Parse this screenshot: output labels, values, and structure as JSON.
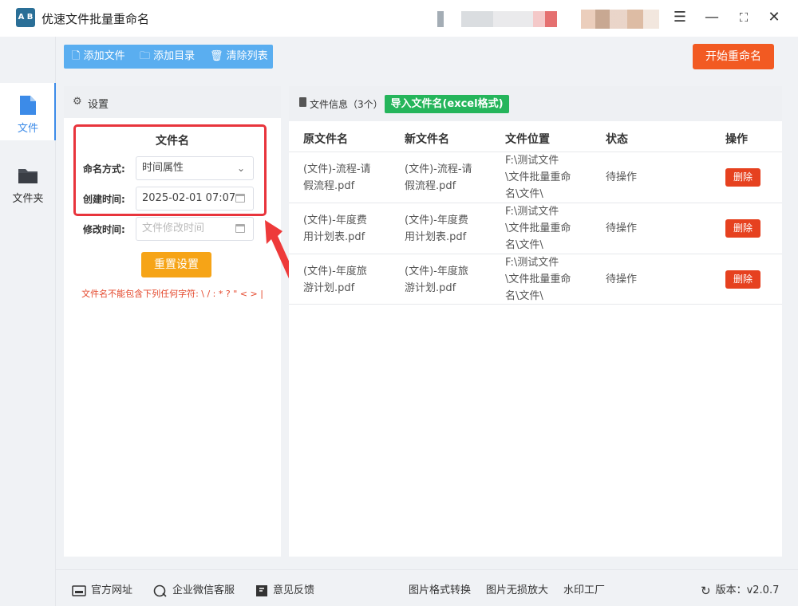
{
  "app": {
    "title": "优速文件批量重命名",
    "logo_text": "A B"
  },
  "window_controls": {
    "menu": "☰",
    "minimize": "—",
    "maximize": "⛶",
    "close": "✕"
  },
  "nav": {
    "items": [
      {
        "label": "文件",
        "icon": "file-icon",
        "active": true
      },
      {
        "label": "文件夹",
        "icon": "folder-icon",
        "active": false
      }
    ]
  },
  "toolbar": {
    "add_file": "添加文件",
    "add_dir": "添加目录",
    "clear_list": "清除列表",
    "start": "开始重命名"
  },
  "settings": {
    "header": "设置",
    "section_title": "文件名",
    "naming_label": "命名方式:",
    "naming_value": "时间属性",
    "created_label": "创建时间:",
    "created_value": "2025-02-01 07:07",
    "modified_label": "修改时间:",
    "modified_placeholder": "文件修改时间",
    "reset": "重置设置",
    "warning": "文件名不能包含下列任何字符: \\ / : * ? \" < > |"
  },
  "files": {
    "header": "文件信息（3个）",
    "import_btn": "导入文件名(excel格式)",
    "columns": [
      "原文件名",
      "新文件名",
      "文件位置",
      "状态",
      "操作"
    ],
    "rows": [
      {
        "orig_1": "(文件)-流程-请",
        "orig_2": "假流程.pdf",
        "new_1": "(文件)-流程-请",
        "new_2": "假流程.pdf",
        "loc_1": "F:\\测试文件",
        "loc_2": "\\文件批量重命",
        "loc_3": "名\\文件\\",
        "status": "待操作",
        "action": "删除"
      },
      {
        "orig_1": "(文件)-年度费",
        "orig_2": "用计划表.pdf",
        "new_1": "(文件)-年度费",
        "new_2": "用计划表.pdf",
        "loc_1": "F:\\测试文件",
        "loc_2": "\\文件批量重命",
        "loc_3": "名\\文件\\",
        "status": "待操作",
        "action": "删除"
      },
      {
        "orig_1": "(文件)-年度旅",
        "orig_2": "游计划.pdf",
        "new_1": "(文件)-年度旅",
        "new_2": "游计划.pdf",
        "loc_1": "F:\\测试文件",
        "loc_2": "\\文件批量重命",
        "loc_3": "名\\文件\\",
        "status": "待操作",
        "action": "删除"
      }
    ]
  },
  "bottom": {
    "website": "官方网址",
    "wechat": "企业微信客服",
    "feedback": "意见反馈",
    "img_convert": "图片格式转换",
    "img_enlarge": "图片无损放大",
    "watermark": "水印工厂",
    "version": "版本：v2.0.7"
  },
  "colors": {
    "accent_blue": "#3c8be8",
    "start_orange": "#f25a22",
    "reset_orange": "#f6a417",
    "import_green": "#25b55b",
    "delete_red": "#e6411f",
    "highlight_red": "#e8343c"
  }
}
